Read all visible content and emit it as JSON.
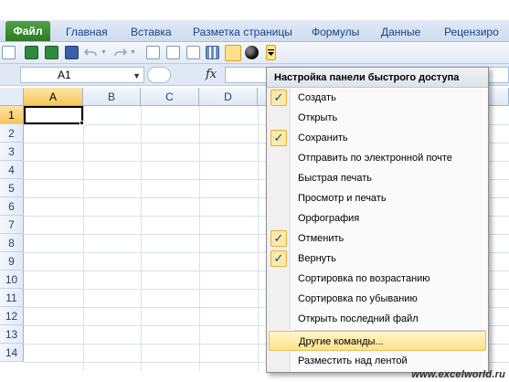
{
  "ribbon": {
    "file_tab": "Файл",
    "tabs": [
      "Главная",
      "Вставка",
      "Разметка страницы",
      "Формулы",
      "Данные",
      "Рецензиро"
    ]
  },
  "formula_bar": {
    "name_box": "A1",
    "fx_label": "fx"
  },
  "sheet": {
    "columns": [
      "A",
      "B",
      "C",
      "D"
    ],
    "rows": [
      "1",
      "2",
      "3",
      "4",
      "5",
      "6",
      "7",
      "8",
      "9",
      "10",
      "11",
      "12",
      "13",
      "14"
    ],
    "active_cell": "A1"
  },
  "qat_menu": {
    "title": "Настройка панели быстрого доступа",
    "items": [
      {
        "label": "Создать",
        "checked": true
      },
      {
        "label": "Открыть",
        "checked": false
      },
      {
        "label": "Сохранить",
        "checked": true
      },
      {
        "label": "Отправить по электронной почте",
        "checked": false
      },
      {
        "label": "Быстрая печать",
        "checked": false
      },
      {
        "label": "Просмотр и печать",
        "checked": false
      },
      {
        "label": "Орфография",
        "checked": false
      },
      {
        "label": "Отменить",
        "checked": true
      },
      {
        "label": "Вернуть",
        "checked": true
      },
      {
        "label": "Сортировка по возрастанию",
        "checked": false
      },
      {
        "label": "Сортировка по убыванию",
        "checked": false
      },
      {
        "label": "Открыть последний файл",
        "checked": false
      },
      {
        "label": "Другие команды...",
        "checked": false,
        "highlighted": true
      },
      {
        "label": "Разместить над лентой",
        "checked": false
      }
    ],
    "check_glyph": "✓"
  },
  "watermark": "www.excelworld.ru",
  "colors": {
    "file_tab": "#2c7a26",
    "menu_highlight": "#fbe28a",
    "check_bg": "#fce9a8",
    "header_active": "#f6c45b"
  }
}
